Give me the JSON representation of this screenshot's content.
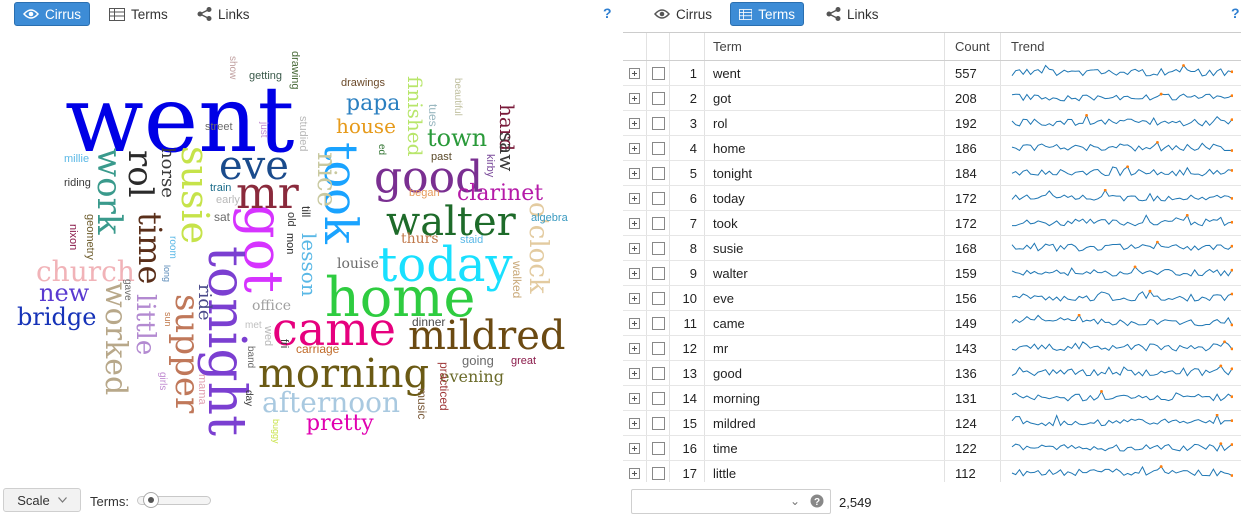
{
  "left_panel": {
    "tabs": [
      {
        "label": "Cirrus",
        "active": true,
        "icon": "eye-icon"
      },
      {
        "label": "Terms",
        "active": false,
        "icon": "table-icon"
      },
      {
        "label": "Links",
        "active": false,
        "icon": "share-icon"
      }
    ],
    "help": "?",
    "cloud_words": [
      {
        "text": "went",
        "color": "#0000e6",
        "rotate": false
      },
      {
        "text": "took",
        "color": "#1aa3ff",
        "rotate": true
      },
      {
        "text": "home",
        "color": "#2ecc40",
        "rotate": false
      },
      {
        "text": "got",
        "color": "#d633ff",
        "rotate": true
      },
      {
        "text": "tonight",
        "color": "#7b3fd1",
        "rotate": true
      },
      {
        "text": "today",
        "color": "#19e0ff",
        "rotate": false
      },
      {
        "text": "walter",
        "color": "#1e6b2a",
        "rotate": false
      },
      {
        "text": "came",
        "color": "#e6007e",
        "rotate": false
      },
      {
        "text": "morning",
        "color": "#6b5a14",
        "rotate": false
      },
      {
        "text": "mildred",
        "color": "#6b4a12",
        "rotate": false
      },
      {
        "text": "good",
        "color": "#7a2f91",
        "rotate": false
      },
      {
        "text": "mr",
        "color": "#8a2a3c",
        "rotate": false
      },
      {
        "text": "eve",
        "color": "#1a4b8c",
        "rotate": false
      },
      {
        "text": "susie",
        "color": "#c6e34a",
        "rotate": true
      },
      {
        "text": "rol",
        "color": "#2a2a2a",
        "rotate": true
      },
      {
        "text": "time",
        "color": "#5a2f1a",
        "rotate": true
      },
      {
        "text": "work",
        "color": "#3a9a8c",
        "rotate": true
      },
      {
        "text": "church",
        "color": "#f1b3b8",
        "rotate": false
      },
      {
        "text": "new",
        "color": "#5a3ad1",
        "rotate": false
      },
      {
        "text": "bridge",
        "color": "#1633b8",
        "rotate": false
      },
      {
        "text": "worked",
        "color": "#b8a88a",
        "rotate": true
      },
      {
        "text": "little",
        "color": "#b38ad1",
        "rotate": true
      },
      {
        "text": "supper",
        "color": "#c0785a",
        "rotate": true
      },
      {
        "text": "afternoon",
        "color": "#a9c9e0",
        "rotate": false
      },
      {
        "text": "pretty",
        "color": "#e000b0",
        "rotate": false
      },
      {
        "text": "papa",
        "color": "#2a7fc0",
        "rotate": false
      },
      {
        "text": "house",
        "color": "#e69a1a",
        "rotate": false
      },
      {
        "text": "town",
        "color": "#2a9a3a",
        "rotate": false
      },
      {
        "text": "clarinet",
        "color": "#b51aa8",
        "rotate": false
      },
      {
        "text": "o'clock",
        "color": "#e3cba0",
        "rotate": true
      },
      {
        "text": "nice",
        "color": "#c9c9a0",
        "rotate": true
      },
      {
        "text": "lesson",
        "color": "#5ab8e6",
        "rotate": true
      },
      {
        "text": "finished",
        "color": "#b8e66b",
        "rotate": true
      },
      {
        "text": "hard",
        "color": "#7a1a3a",
        "rotate": true
      },
      {
        "text": "saw",
        "color": "#3a3a3a",
        "rotate": true
      },
      {
        "text": "evening",
        "color": "#6b6b2a",
        "rotate": false
      },
      {
        "text": "louise",
        "color": "#6b6b6b",
        "rotate": false
      },
      {
        "text": "thurs",
        "color": "#c0784a",
        "rotate": false
      },
      {
        "text": "office",
        "color": "#a0a0a0",
        "rotate": false
      },
      {
        "text": "ride",
        "color": "#4a4a8a",
        "rotate": true
      },
      {
        "text": "horse",
        "color": "#3a3a3a",
        "rotate": true
      },
      {
        "text": "walked",
        "color": "#c9a97a",
        "rotate": true
      },
      {
        "text": "music",
        "color": "#7a5a3a",
        "rotate": true
      },
      {
        "text": "practiced",
        "color": "#a03a3a",
        "rotate": true
      },
      {
        "text": "going",
        "color": "#6b6b6b",
        "rotate": false
      },
      {
        "text": "great",
        "color": "#8a1a4a",
        "rotate": false
      },
      {
        "text": "dinner",
        "color": "#4a4a4a",
        "rotate": false
      },
      {
        "text": "carriage",
        "color": "#c06b2a",
        "rotate": false
      },
      {
        "text": "staid",
        "color": "#5ab8e6",
        "rotate": false
      },
      {
        "text": "algebra",
        "color": "#3a9ac0",
        "rotate": false
      },
      {
        "text": "kirby",
        "color": "#7a4a9a",
        "rotate": true
      },
      {
        "text": "began",
        "color": "#e69a5a",
        "rotate": false
      },
      {
        "text": "past",
        "color": "#5a4a2a",
        "rotate": false
      },
      {
        "text": "tues",
        "color": "#9ab8c0",
        "rotate": true
      },
      {
        "text": "beautiful",
        "color": "#c0c0a0",
        "rotate": true
      },
      {
        "text": "drawings",
        "color": "#6b4a2a",
        "rotate": false
      },
      {
        "text": "getting",
        "color": "#3a5a4a",
        "rotate": false
      },
      {
        "text": "drawing",
        "color": "#4a6b3a",
        "rotate": true
      },
      {
        "text": "show",
        "color": "#c0a0a0",
        "rotate": true
      },
      {
        "text": "street",
        "color": "#6b6b6b",
        "rotate": false
      },
      {
        "text": "just",
        "color": "#c08ad1",
        "rotate": true
      },
      {
        "text": "studied",
        "color": "#b8b8b8",
        "rotate": true
      },
      {
        "text": "millie",
        "color": "#5ab8e6",
        "rotate": false
      },
      {
        "text": "riding",
        "color": "#3a3a3a",
        "rotate": false
      },
      {
        "text": "geometry",
        "color": "#6b5a2a",
        "rotate": true
      },
      {
        "text": "nixon",
        "color": "#8a1a4a",
        "rotate": true
      },
      {
        "text": "train",
        "color": "#1a6b8a",
        "rotate": false
      },
      {
        "text": "early",
        "color": "#b8b8b8",
        "rotate": false
      },
      {
        "text": "sat",
        "color": "#6b6b6b",
        "rotate": false
      },
      {
        "text": "old",
        "color": "#3a3a3a",
        "rotate": true
      },
      {
        "text": "till",
        "color": "#3a3a3a",
        "rotate": true
      },
      {
        "text": "mon",
        "color": "#2a2a2a",
        "rotate": true
      },
      {
        "text": "room",
        "color": "#5ab8e6",
        "rotate": true
      },
      {
        "text": "long",
        "color": "#5a8ab8",
        "rotate": true
      },
      {
        "text": "gave",
        "color": "#6b6b6b",
        "rotate": true
      },
      {
        "text": "sun",
        "color": "#c0784a",
        "rotate": true
      },
      {
        "text": "girls",
        "color": "#c08ad1",
        "rotate": true
      },
      {
        "text": "mama",
        "color": "#e0a0b0",
        "rotate": true
      },
      {
        "text": "met",
        "color": "#c0c0c0",
        "rotate": false
      },
      {
        "text": "wed",
        "color": "#b8b8b8",
        "rotate": true
      },
      {
        "text": "band",
        "color": "#6b6b6b",
        "rotate": true
      },
      {
        "text": "fri",
        "color": "#3a3a3a",
        "rotate": true
      },
      {
        "text": "day",
        "color": "#3a3a3a",
        "rotate": true
      },
      {
        "text": "buggy",
        "color": "#c9e34a",
        "rotate": true
      },
      {
        "text": "ed",
        "color": "#3a7a3a",
        "rotate": true
      }
    ],
    "scale_label": "Scale",
    "terms_label": "Terms:",
    "terms_slider_level": 0.1
  },
  "right_panel": {
    "tabs": [
      {
        "label": "Cirrus",
        "active": false,
        "icon": "eye-icon"
      },
      {
        "label": "Terms",
        "active": true,
        "icon": "table-icon"
      },
      {
        "label": "Links",
        "active": false,
        "icon": "share-icon"
      }
    ],
    "help": "?",
    "table": {
      "columns": [
        "Term",
        "Count",
        "Trend"
      ],
      "rows": [
        {
          "num": "1",
          "term": "went",
          "count": "557"
        },
        {
          "num": "2",
          "term": "got",
          "count": "208"
        },
        {
          "num": "3",
          "term": "rol",
          "count": "192"
        },
        {
          "num": "4",
          "term": "home",
          "count": "186"
        },
        {
          "num": "5",
          "term": "tonight",
          "count": "184"
        },
        {
          "num": "6",
          "term": "today",
          "count": "172"
        },
        {
          "num": "7",
          "term": "took",
          "count": "172"
        },
        {
          "num": "8",
          "term": "susie",
          "count": "168"
        },
        {
          "num": "9",
          "term": "walter",
          "count": "159"
        },
        {
          "num": "10",
          "term": "eve",
          "count": "156"
        },
        {
          "num": "11",
          "term": "came",
          "count": "149"
        },
        {
          "num": "12",
          "term": "mr",
          "count": "143"
        },
        {
          "num": "13",
          "term": "good",
          "count": "136"
        },
        {
          "num": "14",
          "term": "morning",
          "count": "131"
        },
        {
          "num": "15",
          "term": "mildred",
          "count": "124"
        },
        {
          "num": "16",
          "term": "time",
          "count": "122"
        },
        {
          "num": "17",
          "term": "little",
          "count": "112"
        }
      ]
    },
    "search_placeholder": "",
    "total": "2,549",
    "colors": {
      "sparkline": "#1f77b4",
      "sparkline_marker": "#ff7f0e",
      "active_tab": "#3d8cd6"
    }
  }
}
